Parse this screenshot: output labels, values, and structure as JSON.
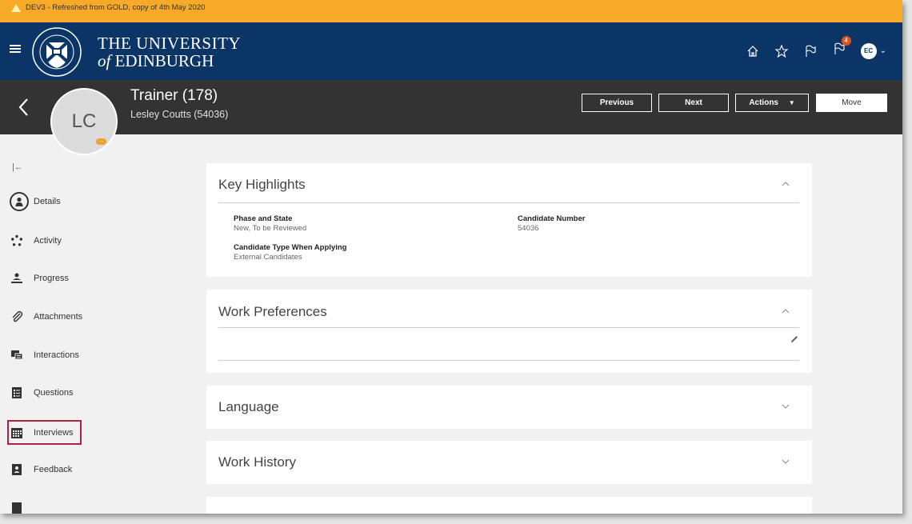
{
  "env_banner": {
    "text": "DEV3 - Refreshed from GOLD, copy of 4th May 2020"
  },
  "header": {
    "uni_line1": "THE UNIVERSITY",
    "uni_line2_prefix": "of",
    "uni_line2_main": "EDINBURGH",
    "notifications_count": "4",
    "user_initials": "EC",
    "colors": {
      "header_bg": "#0b3566",
      "banner_bg": "#f7a928",
      "badge": "#d9531e"
    }
  },
  "candidate": {
    "title": "Trainer (178)",
    "subtitle": "Lesley Coutts (54036)",
    "initials": "LC",
    "buttons": {
      "previous": "Previous",
      "next": "Next",
      "actions": "Actions",
      "move": "Move"
    }
  },
  "nav": {
    "items": [
      {
        "label": "Details",
        "icon": "person-circle-icon"
      },
      {
        "label": "Activity",
        "icon": "activity-icon"
      },
      {
        "label": "Progress",
        "icon": "progress-icon"
      },
      {
        "label": "Attachments",
        "icon": "paperclip-icon"
      },
      {
        "label": "Interactions",
        "icon": "interactions-icon"
      },
      {
        "label": "Questions",
        "icon": "questions-icon"
      },
      {
        "label": "Interviews",
        "icon": "calendar-icon"
      },
      {
        "label": "Feedback",
        "icon": "feedback-icon"
      }
    ]
  },
  "panels": {
    "key_highlights": {
      "title": "Key Highlights",
      "phase_label": "Phase and State",
      "phase_value": "New, To be Reviewed",
      "candidate_number_label": "Candidate Number",
      "candidate_number_value": "54036",
      "candidate_type_label": "Candidate Type When Applying",
      "candidate_type_value": "External Candidates"
    },
    "work_preferences": {
      "title": "Work Preferences"
    },
    "language": {
      "title": "Language"
    },
    "work_history": {
      "title": "Work History"
    }
  }
}
